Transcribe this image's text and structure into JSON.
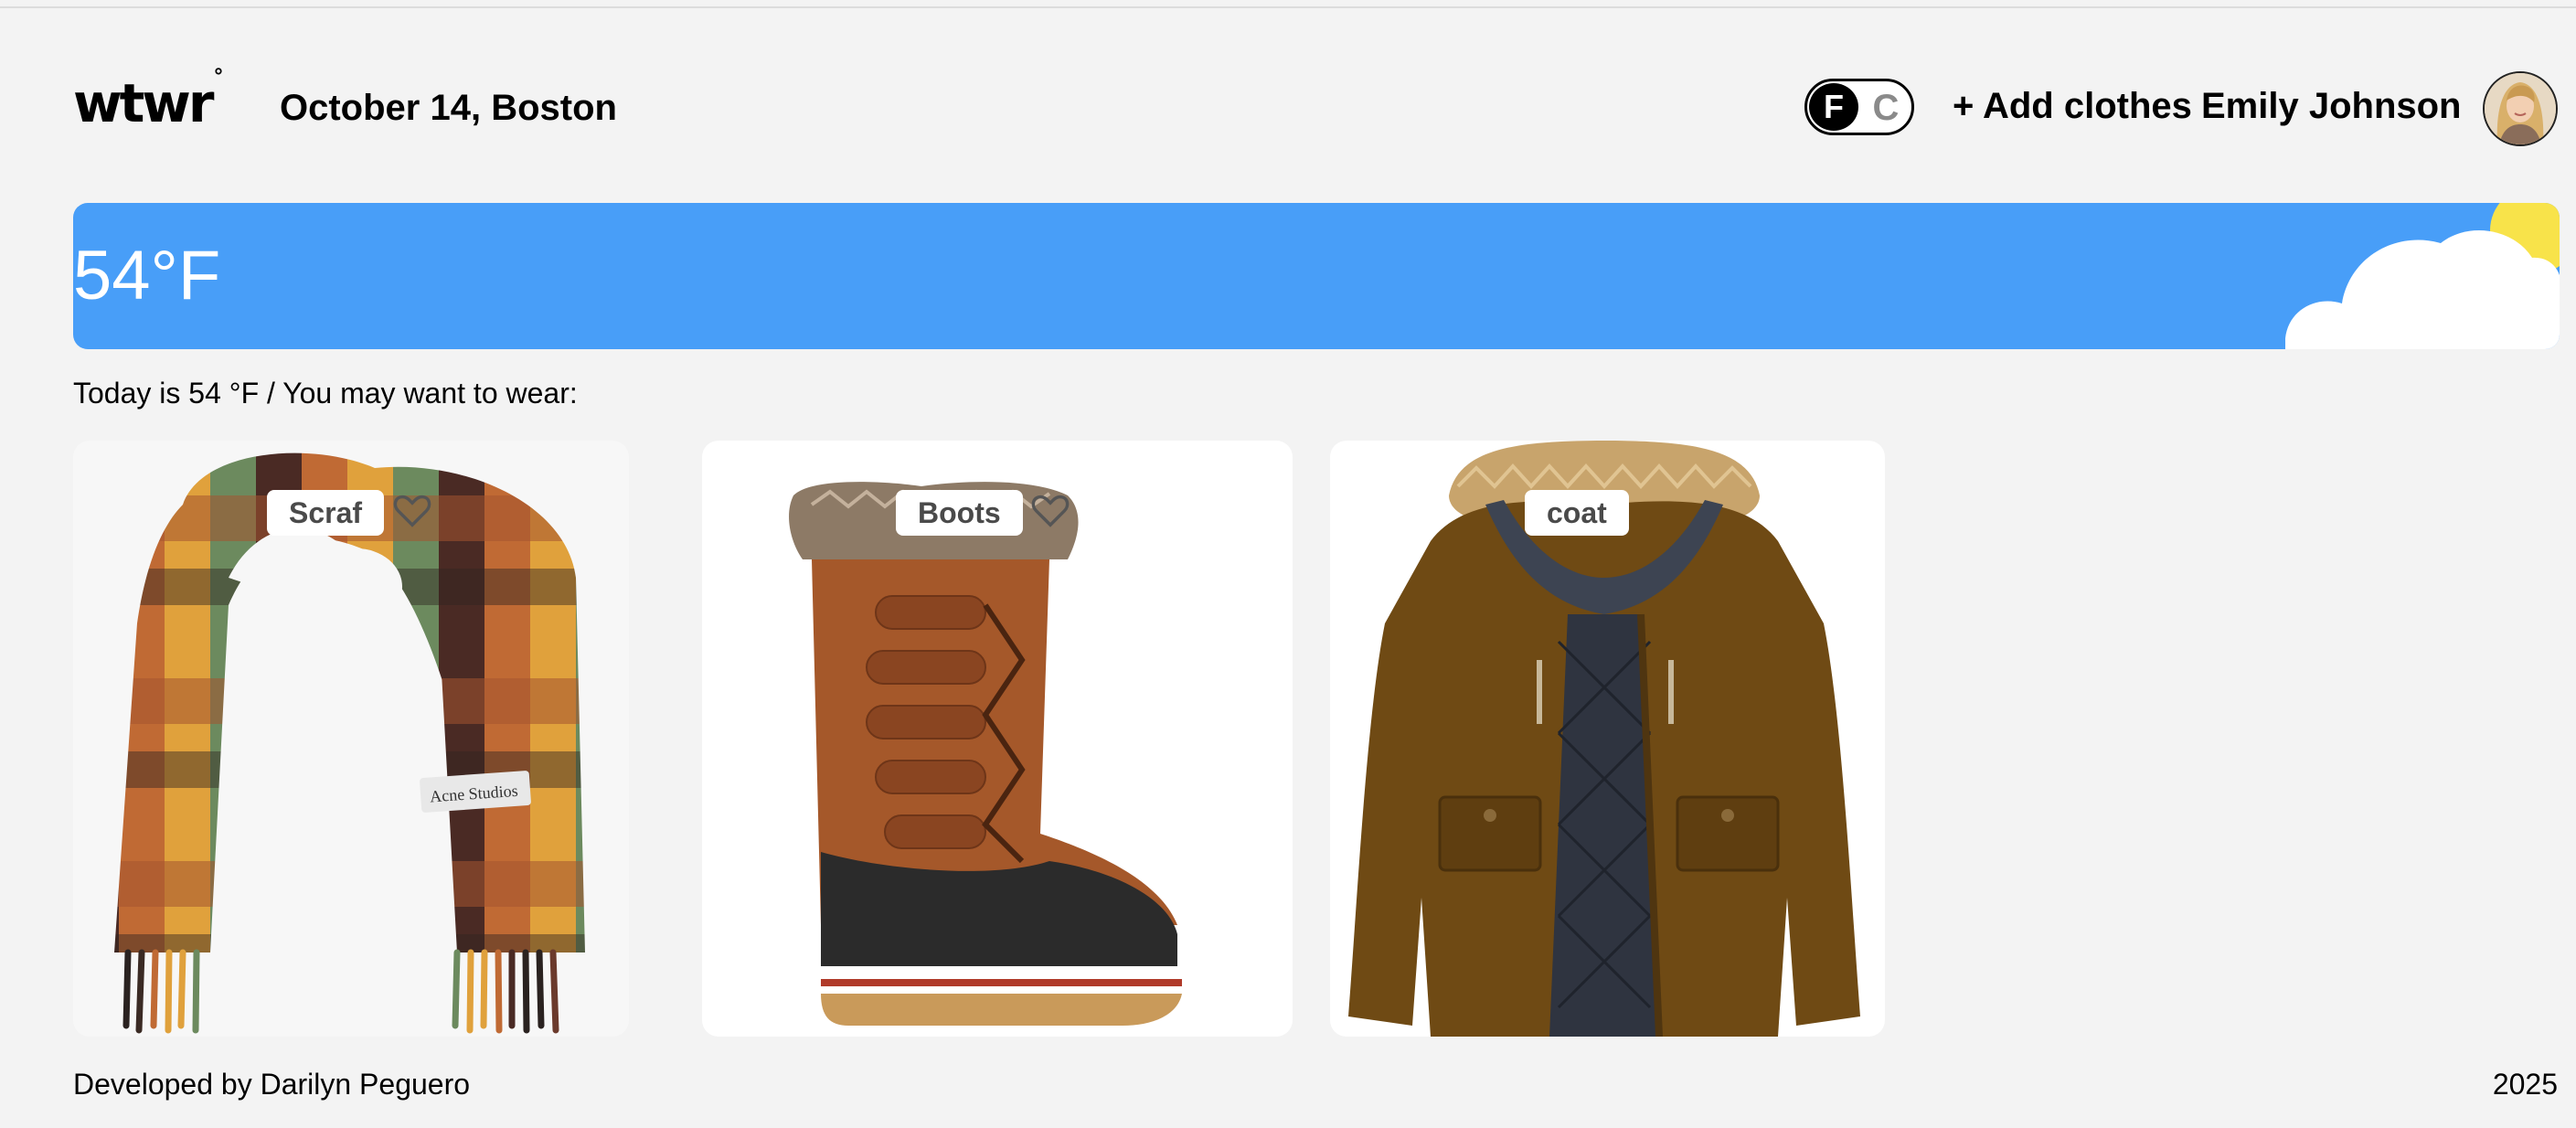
{
  "header": {
    "logo": "wtwr",
    "logo_mark": "°",
    "date_location": "October 14, Boston",
    "unit_toggle": {
      "active": "F",
      "inactive": "C"
    },
    "add_clothes_label": "+ Add clothes",
    "user_name": "Emily Johnson",
    "avatar_icon": "user-avatar"
  },
  "weather": {
    "temperature": "54°F",
    "condition_icons": [
      "sun-icon",
      "cloud-icon"
    ],
    "banner_color": "#489ef8"
  },
  "suggestion_text": "Today is 54 °F / You may want to wear:",
  "items": [
    {
      "name": "Scraf",
      "image": "plaid-scarf",
      "image_text": "Acne Studios",
      "liked": false
    },
    {
      "name": "Boots",
      "image": "winter-boot",
      "liked": false
    },
    {
      "name": "coat",
      "image": "brown-parka",
      "liked": false
    }
  ],
  "footer": {
    "credit": "Developed by Darilyn Peguero",
    "year": "2025"
  }
}
